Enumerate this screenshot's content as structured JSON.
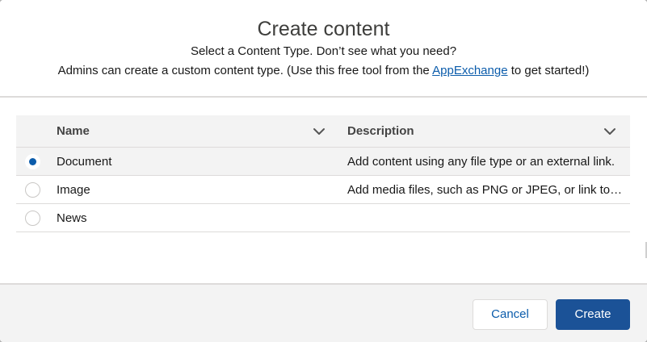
{
  "modal": {
    "title": "Create content",
    "subtitle": "Select a Content Type. Don’t see what you need?",
    "admin_text_prefix": "Admins can create a custom content type. (Use this free tool from the ",
    "admin_link": "AppExchange",
    "admin_text_suffix": " to get started!)"
  },
  "table": {
    "columns": {
      "name": "Name",
      "description": "Description"
    },
    "rows": [
      {
        "name": "Document",
        "description": "Add content using any file type or an external link.",
        "selected": true
      },
      {
        "name": "Image",
        "description": "Add media files, such as PNG or JPEG, or link to images.",
        "selected": false
      },
      {
        "name": "News",
        "description": "",
        "selected": false
      }
    ]
  },
  "footer": {
    "cancel_label": "Cancel",
    "create_label": "Create"
  },
  "colors": {
    "brand_button": "#1b5297",
    "link": "#0b5cab",
    "radio_selected": "#0b5cab"
  },
  "icons": {
    "column_menu": "chevron-down-icon",
    "row_select": "radio-icon"
  }
}
